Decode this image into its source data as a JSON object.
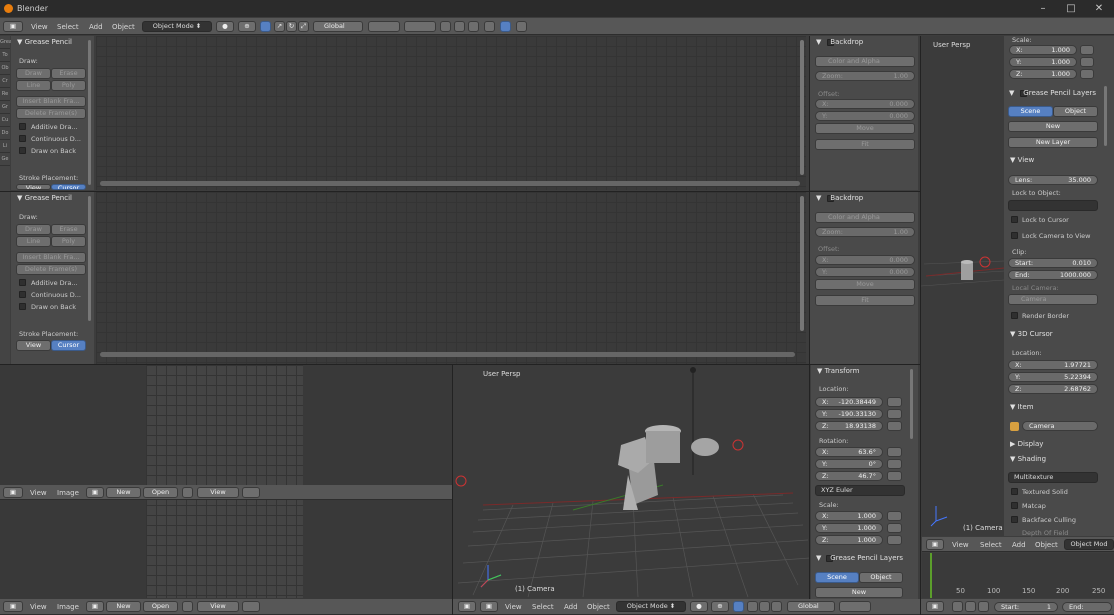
{
  "window": {
    "title": "Blender"
  },
  "top_header": {
    "menus": [
      "View",
      "Select",
      "Add",
      "Object"
    ],
    "mode": "Object Mode",
    "orientation": "Global"
  },
  "gp_tool_panel": {
    "title": "Grease Pencil",
    "draw_label": "Draw:",
    "draw": "Draw",
    "erase": "Erase",
    "line": "Line",
    "poly": "Poly",
    "insert_blank": "Insert Blank Fra...",
    "delete_frames": "Delete Frame(s)",
    "additive": "Additive Dra...",
    "continuous": "Continuous D...",
    "draw_on_back": "Draw on Back",
    "stroke_placement": "Stroke Placement:",
    "view": "View",
    "cursor": "Cursor"
  },
  "backdrop_panel": {
    "title": "Backdrop",
    "mode": "Color and Alpha",
    "zoom_label": "Zoom:",
    "zoom": "1.00",
    "offset_label": "Offset:",
    "x_label": "X:",
    "x": "0.000",
    "y_label": "Y:",
    "y": "0.000",
    "move": "Move",
    "fit": "Fit"
  },
  "left_tabs": [
    "Grea",
    "To",
    "Ob",
    "Cr",
    "Re",
    "Gr",
    "Cu",
    "Do",
    "Li",
    "Ge"
  ],
  "image_header": {
    "menus": [
      "View",
      "Image"
    ],
    "new": "New",
    "open": "Open",
    "view": "View"
  },
  "viewport_center": {
    "label": "User Persp",
    "caption": "(1) Camera"
  },
  "transform_panel": {
    "title": "Transform",
    "location_label": "Location:",
    "x": "-120.38449",
    "y": "-190.33130",
    "z": "18.93138",
    "rotation_label": "Rotation:",
    "rx": "63.6°",
    "ry": "0°",
    "rz": "46.7°",
    "rotation_mode": "XYZ Euler",
    "scale_label": "Scale:",
    "sx": "1.000",
    "sy": "1.000",
    "sz": "1.000"
  },
  "gp_layers": {
    "title": "Grease Pencil Layers",
    "scene": "Scene",
    "object": "Object",
    "new": "New",
    "new_layer": "New Layer"
  },
  "viewport_header": {
    "menus": [
      "View",
      "Select",
      "Add",
      "Object"
    ],
    "mode": "Object Mode",
    "orientation": "Global"
  },
  "right_viewport": {
    "label": "User Persp",
    "caption": "(1) Camera"
  },
  "right_panel": {
    "scale_label": "Scale:",
    "x": "1.000",
    "y": "1.000",
    "z": "1.000",
    "view_title": "View",
    "lens_label": "Lens:",
    "lens": "35.000",
    "lock_to_object": "Lock to Object:",
    "lock_to_cursor": "Lock to Cursor",
    "lock_camera": "Lock Camera to View",
    "clip_label": "Clip:",
    "start_label": "Start:",
    "start": "0.010",
    "end_label": "End:",
    "end": "1000.000",
    "local_camera": "Local Camera:",
    "camera": "Camera",
    "render_border": "Render Border",
    "cursor_title": "3D Cursor",
    "location_label": "Location:",
    "cx": "1.97721",
    "cy": "5.22394",
    "cz": "2.68762",
    "item_title": "Item",
    "item_name": "Camera",
    "display_title": "Display",
    "shading_title": "Shading",
    "shading_mode": "Multitexture",
    "textured_solid": "Textured Solid",
    "matcap": "Matcap",
    "backface": "Backface Culling",
    "depth": "Depth Of Field"
  },
  "timeline": {
    "ticks": [
      "50",
      "100",
      "150",
      "200",
      "250"
    ],
    "start_label": "Start:",
    "start": "1",
    "end_label": "End:",
    "menus": [
      "View",
      "Select",
      "Add",
      "Object"
    ],
    "mode": "Object Mod"
  },
  "colors": {
    "accent": "#5680c2",
    "bg": "#3d3d3d",
    "header": "#575757",
    "panel": "#4a4a4a"
  }
}
